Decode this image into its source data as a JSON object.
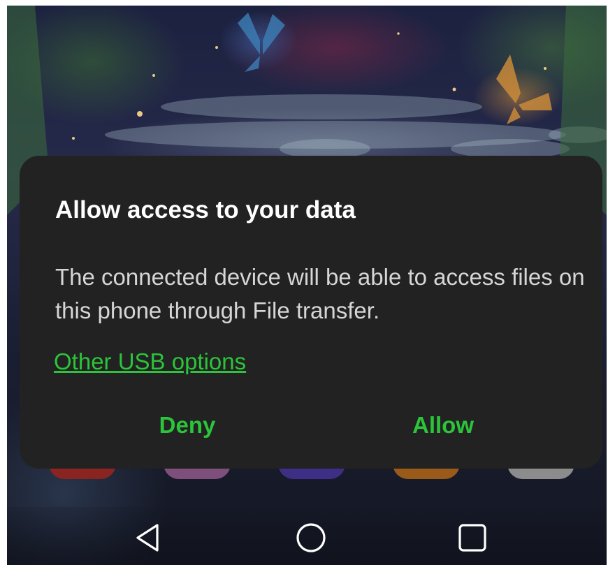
{
  "dialog": {
    "title": "Allow access to your data",
    "message": "The connected device will be able to access files on this phone through File transfer.",
    "link_label": "Other USB options",
    "deny_label": "Deny",
    "allow_label": "Allow"
  },
  "colors": {
    "accent": "#2bc43a",
    "dialog_background": "#222222",
    "title_text": "#ffffff",
    "body_text": "#d6d6d6"
  },
  "navbar": {
    "back_icon": "back-triangle-icon",
    "home_icon": "home-circle-icon",
    "recents_icon": "recents-square-icon"
  }
}
